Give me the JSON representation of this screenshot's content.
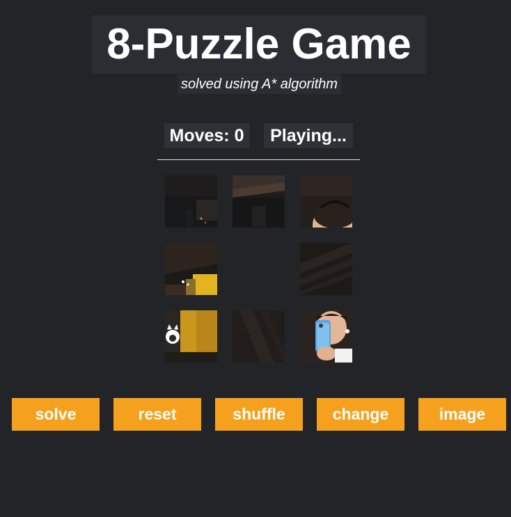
{
  "header": {
    "title": "8-Puzzle Game",
    "subtitle": "solved using A* algorithm"
  },
  "status": {
    "moves_label": "Moves:",
    "moves_count": 0,
    "state": "Playing..."
  },
  "board": {
    "rows": 3,
    "cols": 3,
    "empty_position": [
      1,
      1
    ],
    "tiles": [
      {
        "label": "tile-top-left",
        "desc": "dark ceiling with small lights"
      },
      {
        "label": "tile-top-center",
        "desc": "dark wooden ceiling beam"
      },
      {
        "label": "tile-top-right",
        "desc": "top of head with sunglasses"
      },
      {
        "label": "tile-middle-left",
        "desc": "wall with yellow light"
      },
      {
        "label": "tile-empty",
        "desc": ""
      },
      {
        "label": "tile-middle-right",
        "desc": "dark wooden ceiling"
      },
      {
        "label": "tile-bottom-left",
        "desc": "yellow wall with cat sticker"
      },
      {
        "label": "tile-bottom-center",
        "desc": "dark wood panel"
      },
      {
        "label": "tile-bottom-right",
        "desc": "person holding blue phone"
      }
    ]
  },
  "buttons": {
    "solve": "solve",
    "reset": "reset",
    "shuffle": "shuffle",
    "change": "change",
    "image": "image"
  },
  "colors": {
    "background": "#222428",
    "accent": "#f6a11d",
    "text": "#ffffff"
  }
}
